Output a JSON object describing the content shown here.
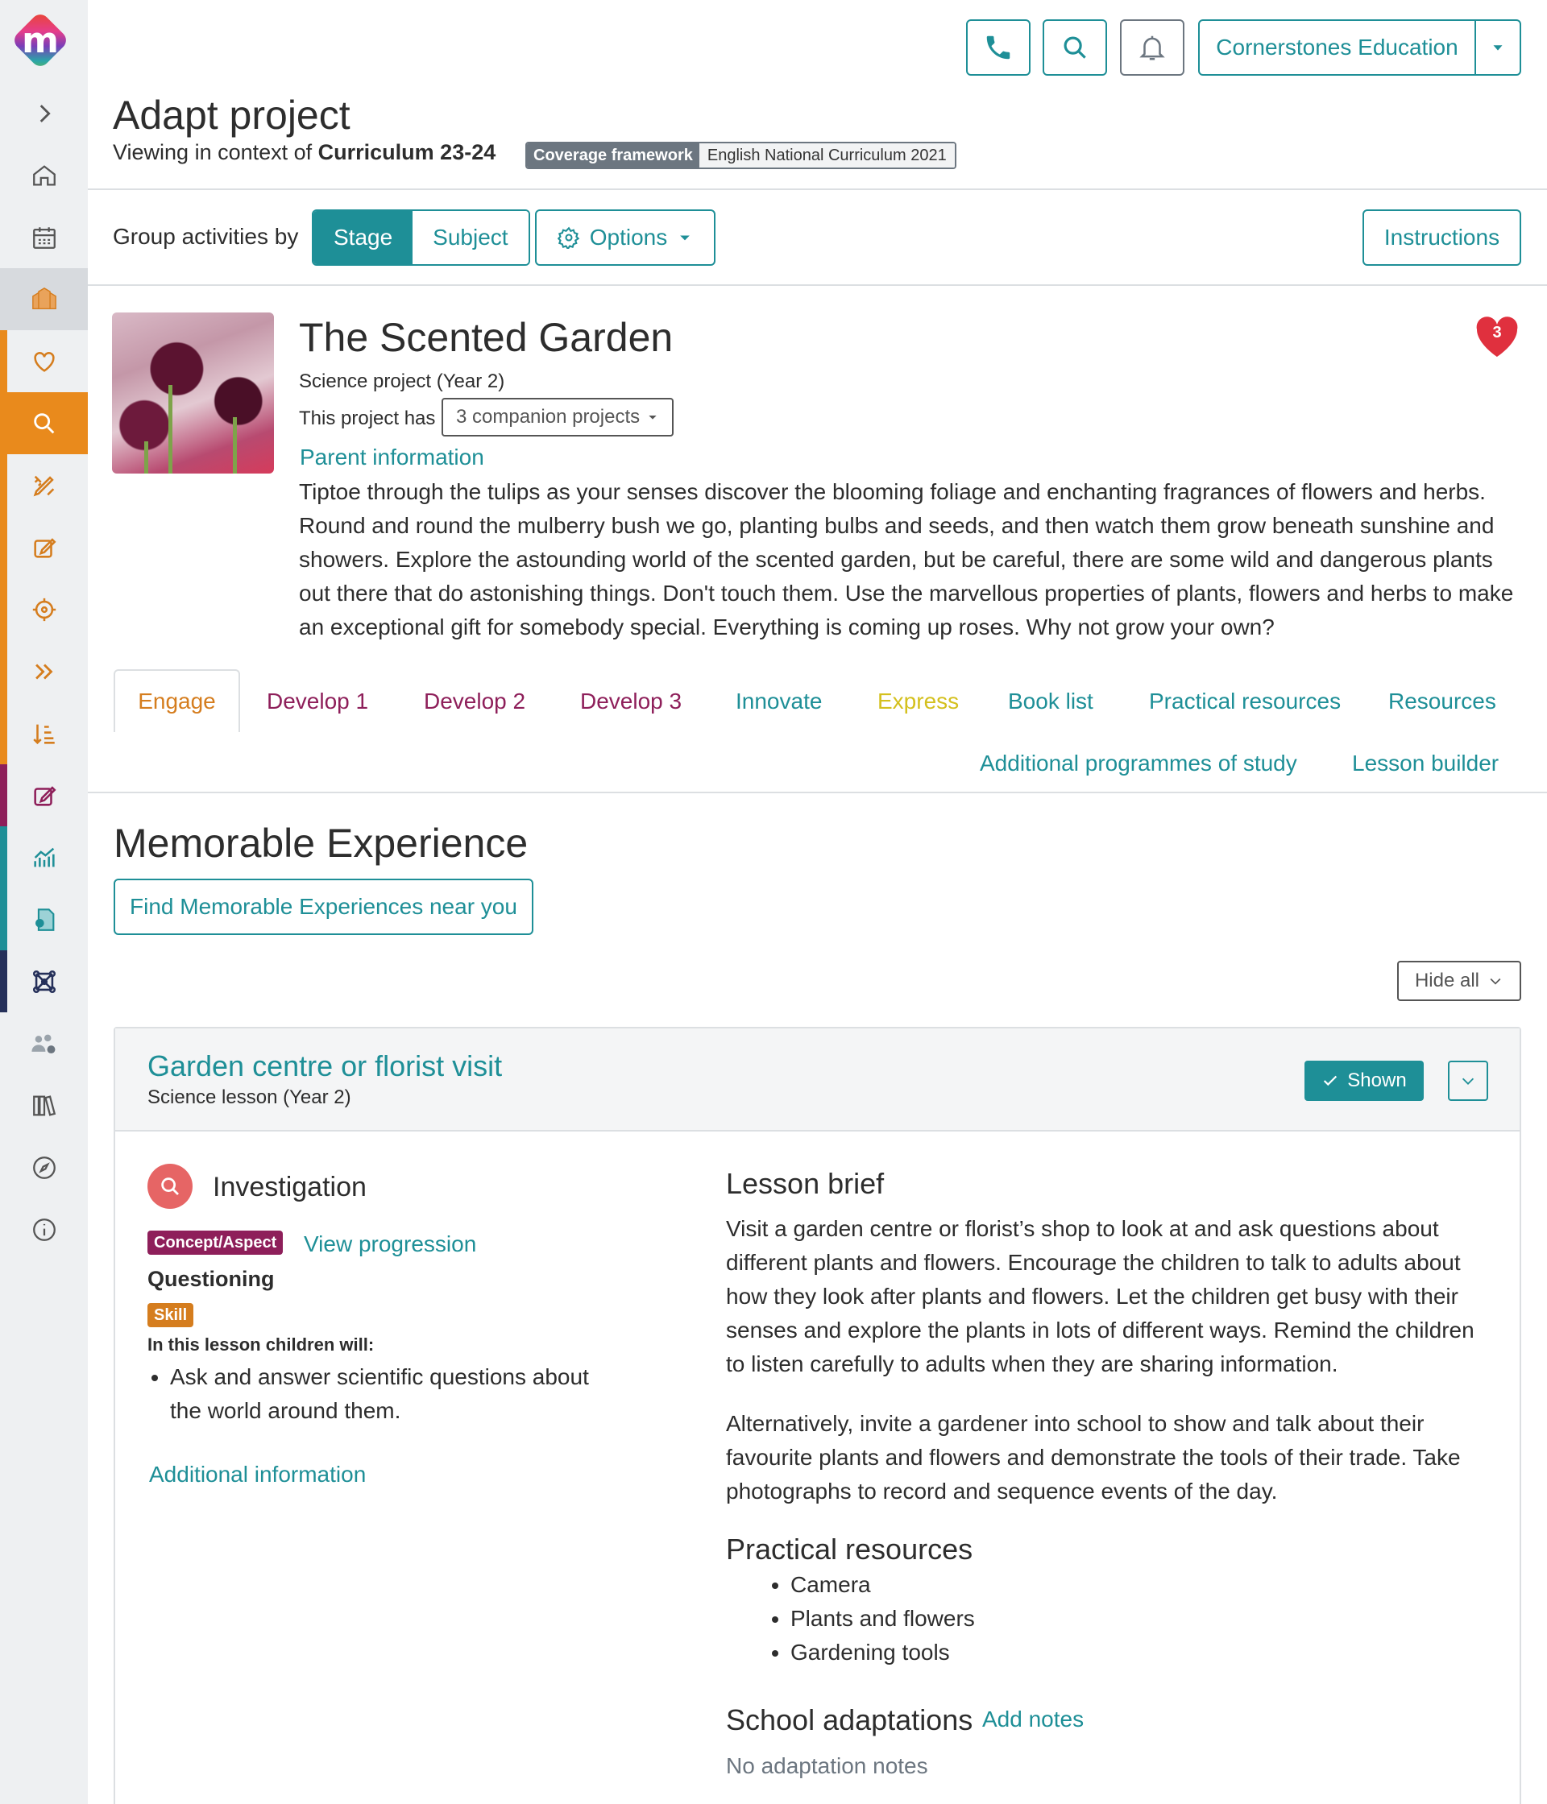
{
  "colors": {
    "accent": "#1e8f97",
    "engage": "#d57d1e",
    "develop": "#8e1f5a",
    "innovate": "#1e8f97",
    "express": "#d4c01e"
  },
  "sidebar": {
    "logo": "m",
    "items": [
      "chevron-right-icon",
      "home-icon",
      "calendar-icon",
      "school-icon",
      "heart-icon",
      "search-icon",
      "pencil-ruler-icon",
      "edit-icon",
      "target-icon",
      "double-chevron-icon",
      "sort-icon",
      "edit-note-icon",
      "chart-icon",
      "certificate-icon",
      "network-icon",
      "users-settings-icon",
      "library-icon",
      "compass-icon",
      "info-icon"
    ]
  },
  "header": {
    "org_name": "Cornerstones Education",
    "title": "Adapt project",
    "context_prefix": "Viewing in context of ",
    "context_value": "Curriculum 23-24",
    "coverage_key": "Coverage framework",
    "coverage_value": "English National Curriculum 2021"
  },
  "toolbar": {
    "group_label": "Group activities by",
    "stage": "Stage",
    "subject": "Subject",
    "options": "Options",
    "instructions": "Instructions"
  },
  "project": {
    "title": "The Scented Garden",
    "subtitle": "Science project (Year 2)",
    "has_label": "This project has",
    "companion": "3 companion projects",
    "parent_info": "Parent information",
    "favourites": "3",
    "description": "Tiptoe through the tulips as your senses discover the blooming foliage and enchanting fragrances of flowers and herbs. Round and round the mulberry bush we go, planting bulbs and seeds, and then watch them grow beneath sunshine and showers. Explore the astounding world of the scented garden, but be careful, there are some wild and dangerous plants out there that do astonishing things. Don't touch them. Use the marvellous properties of plants, flowers and herbs to make an exceptional gift for somebody special. Everything is coming up roses. Why not grow your own?"
  },
  "tabs": [
    "Engage",
    "Develop 1",
    "Develop 2",
    "Develop 3",
    "Innovate",
    "Express",
    "Book list",
    "Practical resources",
    "Resources",
    "Additional programmes of study",
    "Lesson builder"
  ],
  "memorable": {
    "title": "Memorable Experience",
    "find_button": "Find Memorable Experiences near you",
    "hide_all": "Hide all"
  },
  "lesson": {
    "title": "Garden centre or florist visit",
    "subtitle": "Science lesson (Year 2)",
    "shown": "Shown",
    "category": "Investigation",
    "concept_badge": "Concept/Aspect",
    "view_progression": "View progression",
    "concept_name": "Questioning",
    "skill_badge": "Skill",
    "will_label": "In this lesson children will:",
    "will_items": [
      "Ask and answer scientific questions about the world around them."
    ],
    "additional_info": "Additional information",
    "brief_heading": "Lesson brief",
    "brief_p1": "Visit a garden centre or florist’s shop to look at and ask questions about different plants and flowers. Encourage the children to talk to adults about how they look after plants and flowers. Let the children get busy with their senses and explore the plants in lots of different ways. Remind the children to listen carefully to adults when they are sharing information.",
    "brief_p2": "Alternatively, invite a gardener into school to show and talk about their favourite plants and flowers and demonstrate the tools of their trade. Take photographs to record and sequence events of the day.",
    "practical_heading": "Practical resources",
    "practical_items": [
      "Camera",
      "Plants and flowers",
      "Gardening tools"
    ],
    "adapt_heading": "School adaptations",
    "add_notes": "Add notes",
    "no_notes": "No adaptation notes"
  }
}
